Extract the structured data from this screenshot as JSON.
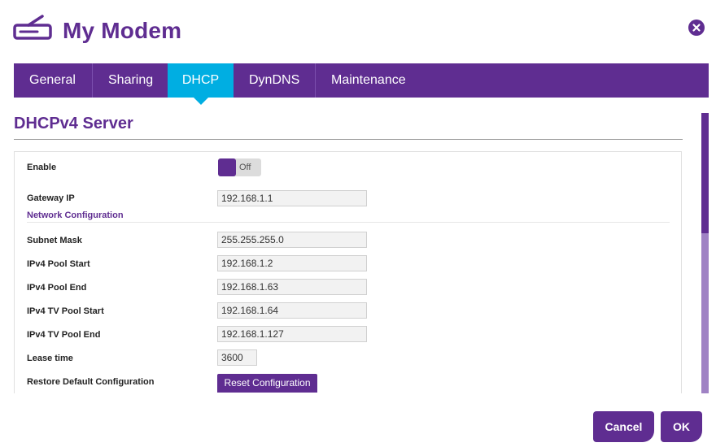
{
  "header": {
    "title": "My Modem",
    "icon": "modem-icon",
    "close_icon": "close-icon",
    "brand_color": "#5f2d91"
  },
  "tabs": [
    {
      "label": "General"
    },
    {
      "label": "Sharing"
    },
    {
      "label": "DHCP",
      "active": true
    },
    {
      "label": "DynDNS"
    },
    {
      "label": "Maintenance"
    }
  ],
  "active_tab_color": "#00aee2",
  "section": {
    "title": "DHCPv4 Server"
  },
  "form": {
    "enable_label": "Enable",
    "enable_state": "Off",
    "gateway_label": "Gateway IP",
    "gateway_value": "192.168.1.1",
    "network_config_label": "Network Configuration",
    "subnet_label": "Subnet Mask",
    "subnet_value": "255.255.255.0",
    "pool_start_label": "IPv4 Pool Start",
    "pool_start_value": "192.168.1.2",
    "pool_end_label": "IPv4 Pool End",
    "pool_end_value": "192.168.1.63",
    "tv_pool_start_label": "IPv4 TV Pool Start",
    "tv_pool_start_value": "192.168.1.64",
    "tv_pool_end_label": "IPv4 TV Pool End",
    "tv_pool_end_value": "192.168.1.127",
    "lease_label": "Lease time",
    "lease_value": "3600",
    "restore_label": "Restore Default Configuration",
    "reset_button": "Reset Configuration"
  },
  "footer": {
    "cancel": "Cancel",
    "ok": "OK"
  }
}
